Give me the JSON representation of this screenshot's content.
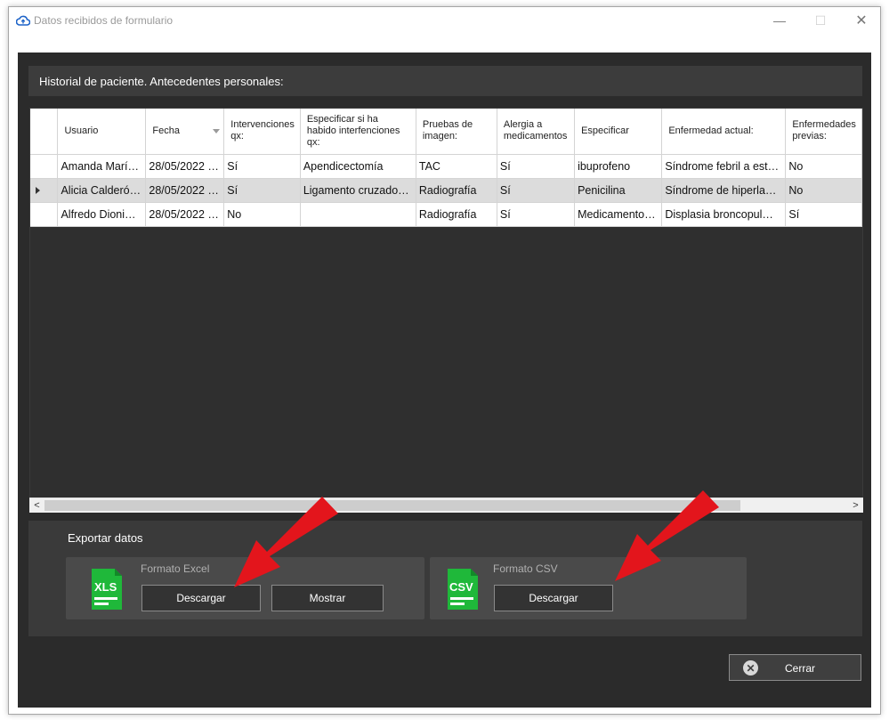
{
  "window": {
    "title": "Datos recibidos de formulario",
    "minimize": "—",
    "maximize": "☐",
    "close": "✕"
  },
  "section_title": "Historial de paciente. Antecedentes personales:",
  "table": {
    "columns": [
      "Usuario",
      "Fecha",
      "Intervenciones qx:",
      "Especificar si ha habido interfenciones qx:",
      "Pruebas de imagen:",
      "Alergia a medicamentos",
      "Especificar",
      "Enfermedad actual:",
      "Enfermedades previas:"
    ],
    "rows": [
      [
        "Amanda Marí…",
        "28/05/2022 …",
        "Sí",
        "Apendicectomía",
        "TAC",
        "Sí",
        "ibuprofeno",
        "Síndrome febril a est…",
        "No"
      ],
      [
        "Alicia Calderó…",
        "28/05/2022 …",
        "Sí",
        "Ligamento cruzado…",
        "Radiografía",
        "Sí",
        "Penicilina",
        "Síndrome de hiperla…",
        "No"
      ],
      [
        "Alfredo Dioni…",
        "28/05/2022 …",
        "No",
        "",
        "Radiografía",
        "Sí",
        "Medicamento…",
        "Displasia broncopul…",
        "Sí"
      ]
    ],
    "selected_row": 1
  },
  "scrollbar": {
    "left": "<",
    "right": ">"
  },
  "export": {
    "title": "Exportar datos",
    "excel": {
      "label": "Formato Excel",
      "icon_text": "XLS",
      "download": "Descargar",
      "show": "Mostrar"
    },
    "csv": {
      "label": "Formato CSV",
      "icon_text": "CSV",
      "download": "Descargar"
    }
  },
  "close_button": {
    "label": "Cerrar",
    "icon": "✕"
  },
  "colors": {
    "background": "#2b2b2b",
    "panel": "#3a3a3a",
    "file_icon_green": "#1fb83a",
    "annotation_arrow": "#e3151c"
  }
}
